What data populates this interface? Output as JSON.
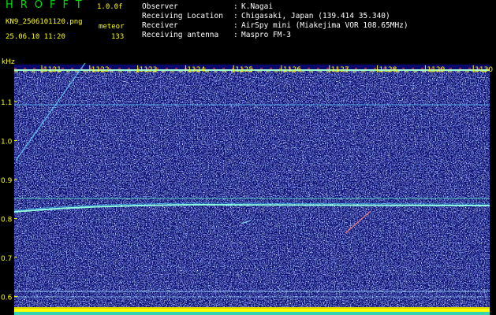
{
  "header": {
    "app_title": "HROFFT",
    "version": "1.0.0f",
    "filename": "KN9_2506101120.png",
    "mode": "meteor",
    "datetime": "25.06.10 11:20",
    "count": "133",
    "meta": [
      {
        "label": "Observer",
        "value": "K.Nagai"
      },
      {
        "label": "Receiving Location",
        "value": "Chigasaki, Japan (139.414 35.340)"
      },
      {
        "label": "Receiver",
        "value": "AirSpy mini (Miakejima VOR 108.65MHz)"
      },
      {
        "label": "Receiving antenna",
        "value": "Maspro FM-3"
      }
    ]
  },
  "axis": {
    "unit": "kHz",
    "y_ticks": [
      "1.1",
      "1.0",
      "0.9",
      "0.8",
      "0.7",
      "0.6"
    ],
    "time_ticks": [
      "1121",
      "1122",
      "1123",
      "1124",
      "1125",
      "1126",
      "1127",
      "1128",
      "1129",
      "1130"
    ]
  },
  "colors": {
    "background": "#0a0a6e",
    "noise": "#3a5cff",
    "trace": "#8fffe0",
    "axis_text": "#ffff00",
    "title": "#00e000"
  }
}
